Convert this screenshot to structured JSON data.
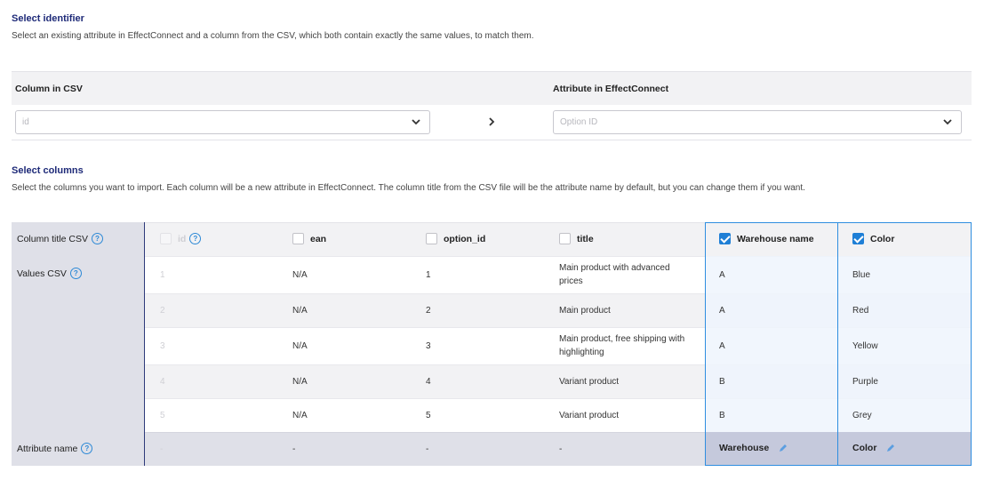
{
  "identifier": {
    "title": "Select identifier",
    "description": "Select an existing attribute in EffectConnect and a column from the CSV, which both contain exactly the same values, to match them.",
    "csv_header": "Column in CSV",
    "attr_header": "Attribute in EffectConnect",
    "csv_value": "id",
    "attr_value": "Option ID"
  },
  "columns": {
    "title": "Select columns",
    "description": "Select the columns you want to import. Each column will be a new attribute in EffectConnect. The column title from the CSV file will be the attribute name by default, but you can change them if you want.",
    "row_labels": {
      "title": "Column title CSV",
      "values": "Values CSV",
      "attribute": "Attribute name"
    },
    "headers": [
      "id",
      "ean",
      "option_id",
      "title",
      "Warehouse name",
      "Color"
    ],
    "checked": [
      false,
      false,
      false,
      false,
      true,
      true
    ],
    "rows": [
      [
        "1",
        "N/A",
        "1",
        "Main product with advanced prices",
        "A",
        "Blue"
      ],
      [
        "2",
        "N/A",
        "2",
        "Main product",
        "A",
        "Red"
      ],
      [
        "3",
        "N/A",
        "3",
        "Main product, free shipping with highlighting",
        "A",
        "Yellow"
      ],
      [
        "4",
        "N/A",
        "4",
        "Variant product",
        "B",
        "Purple"
      ],
      [
        "5",
        "N/A",
        "5",
        "Variant product",
        "B",
        "Grey"
      ]
    ],
    "attribute_names": [
      "-",
      "-",
      "-",
      "-",
      "Warehouse",
      "Color"
    ]
  },
  "icons": {
    "help": "question-circle-icon",
    "chevron": "chevron-down-icon",
    "arrow": "chevron-right-icon",
    "edit": "pencil-icon"
  },
  "colors": {
    "accent": "#2f8ee0",
    "title": "#1e2a78",
    "left_column": "#dfe0e8",
    "selected_column": "#eef5fd",
    "selected_footer": "#c5c9dc"
  }
}
